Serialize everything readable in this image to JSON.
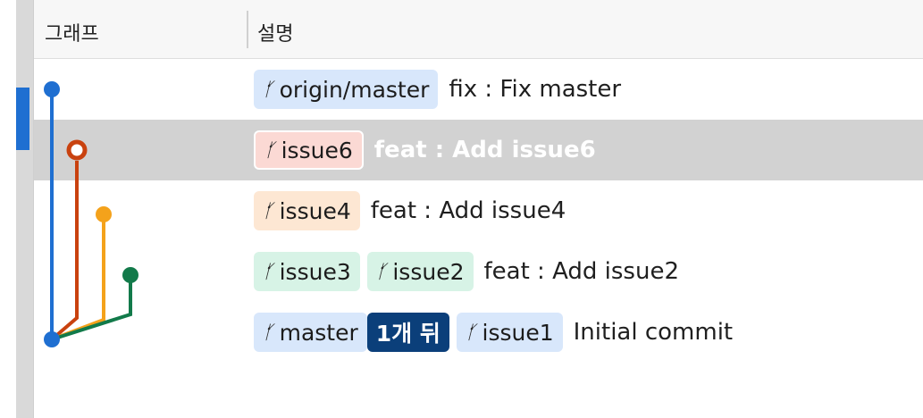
{
  "header": {
    "graph_label": "그래프",
    "description_label": "설명"
  },
  "colors": {
    "blue": "#1f6fd1",
    "red": "#c9420f",
    "orange": "#f4a21b",
    "green": "#127a4a",
    "selected_row": "#d2d2d2",
    "behind_badge": "#0b3f7a"
  },
  "rows": [
    {
      "tags": [
        {
          "label": "origin/master",
          "icon": "branch-icon",
          "color": "blue"
        }
      ],
      "message": "fix : Fix master"
    },
    {
      "tags": [
        {
          "label": "issue6",
          "icon": "branch-icon",
          "color": "red"
        }
      ],
      "message": "feat : Add issue6",
      "selected": true
    },
    {
      "tags": [
        {
          "label": "issue4",
          "icon": "branch-icon",
          "color": "orange"
        }
      ],
      "message": "feat : Add issue4"
    },
    {
      "tags": [
        {
          "label": "issue3",
          "icon": "branch-icon",
          "color": "green"
        },
        {
          "label": "issue2",
          "icon": "branch-icon",
          "color": "green"
        }
      ],
      "message": "feat : Add issue2"
    },
    {
      "tags": [
        {
          "label": "master",
          "icon": "branch-icon",
          "color": "blue",
          "behind": "1개 뒤"
        },
        {
          "label": "issue1",
          "icon": "branch-icon",
          "color": "blue"
        }
      ],
      "message": "Initial commit"
    }
  ]
}
